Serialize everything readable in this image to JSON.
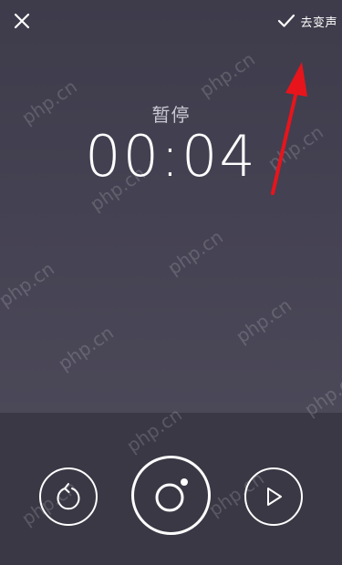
{
  "header": {
    "close_icon": "close-icon",
    "confirm_icon": "checkmark-icon",
    "confirm_label": "去变声"
  },
  "recorder": {
    "status": "暂停",
    "time": "00:04"
  },
  "controls": {
    "rerecord_icon": "undo-circle-icon",
    "record_icon": "record-dot-icon",
    "play_icon": "play-icon"
  },
  "annotation": {
    "arrow_color": "#e8141c"
  },
  "watermark": {
    "text": "php.cn"
  }
}
